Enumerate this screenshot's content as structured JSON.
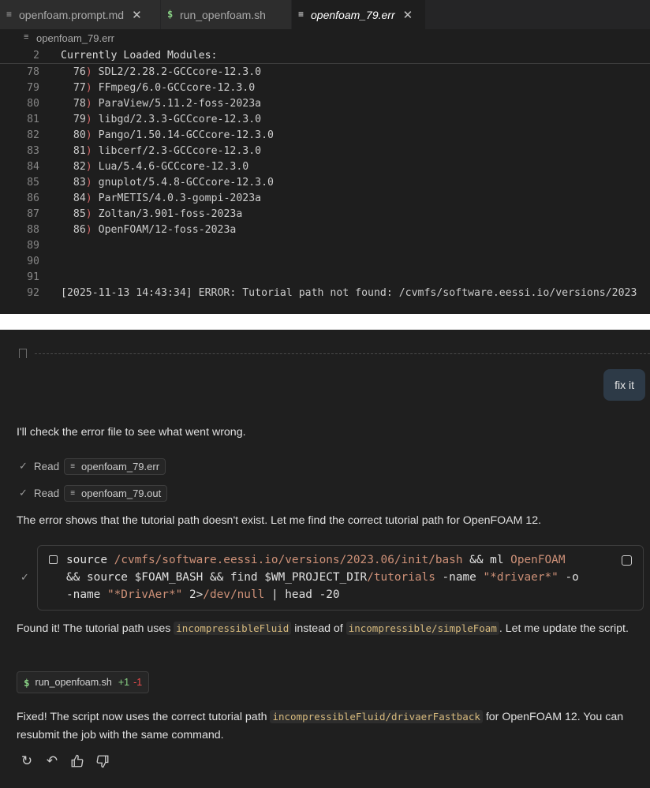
{
  "tabs": [
    {
      "icon": "lines-file-icon",
      "label": "openfoam.prompt.md",
      "close": "✕"
    },
    {
      "icon": "dollar-file-icon",
      "label": "run_openfoam.sh"
    },
    {
      "icon": "lines-file-icon",
      "label": "openfoam_79.err",
      "close": "✕",
      "active": true
    }
  ],
  "breadcrumb": {
    "file": "openfoam_79.err"
  },
  "editor": {
    "sticky": {
      "num": "2",
      "text": "Currently Loaded Modules:"
    },
    "lines": [
      {
        "num": "78",
        "idx": "76",
        "mod": "SDL2/2.28.2-GCCcore-12.3.0"
      },
      {
        "num": "79",
        "idx": "77",
        "mod": "FFmpeg/6.0-GCCcore-12.3.0"
      },
      {
        "num": "80",
        "idx": "78",
        "mod": "ParaView/5.11.2-foss-2023a"
      },
      {
        "num": "81",
        "idx": "79",
        "mod": "libgd/2.3.3-GCCcore-12.3.0"
      },
      {
        "num": "82",
        "idx": "80",
        "mod": "Pango/1.50.14-GCCcore-12.3.0"
      },
      {
        "num": "83",
        "idx": "81",
        "mod": "libcerf/2.3-GCCcore-12.3.0"
      },
      {
        "num": "84",
        "idx": "82",
        "mod": "Lua/5.4.6-GCCcore-12.3.0"
      },
      {
        "num": "85",
        "idx": "83",
        "mod": "gnuplot/5.4.8-GCCcore-12.3.0"
      },
      {
        "num": "86",
        "idx": "84",
        "mod": "ParMETIS/4.0.3-gompi-2023a"
      },
      {
        "num": "87",
        "idx": "85",
        "mod": "Zoltan/3.901-foss-2023a"
      },
      {
        "num": "88",
        "idx": "86",
        "mod": "OpenFOAM/12-foss-2023a"
      }
    ],
    "empty_lines": [
      "89",
      "90",
      "91"
    ],
    "error_line": {
      "num": "92",
      "text": "[2025-11-13 14:43:34] ERROR: Tutorial path not found: /cvmfs/software.eessi.io/versions/2023"
    }
  },
  "chat": {
    "user_message": "fix it",
    "p1": "I'll check the error file to see what went wrong.",
    "read1": {
      "verb": "Read",
      "file": "openfoam_79.err"
    },
    "read2": {
      "verb": "Read",
      "file": "openfoam_79.out"
    },
    "p2": "The error shows that the tutorial path doesn't exist. Let me find the correct tutorial path for OpenFOAM 12.",
    "command": {
      "t1": "source ",
      "t2": "/cvmfs/software.eessi.io/versions/2023.06/init/bash",
      "t3": " && ml ",
      "t4": "OpenFOAM",
      "t5": "&& source $FOAM_BASH && find $WM_PROJECT_DIR",
      "t6": "/tutorials",
      "t7": " -name ",
      "t8": "\"*drivaer*\"",
      "t9": " -o",
      "t10": "-name ",
      "t11": "\"*DrivAer*\"",
      "t12": " 2>",
      "t13": "/dev/null",
      "t14": " | head -20"
    },
    "p3": {
      "a": "Found it! The tutorial path uses ",
      "code1": "incompressibleFluid",
      "b": " instead of ",
      "code2": "incompressible/simpleFoam",
      "c": ". Let me update the script."
    },
    "edit_chip": {
      "file": "run_openfoam.sh",
      "plus": "+1",
      "minus": "-1"
    },
    "p4": {
      "a": "Fixed! The script now uses the correct tutorial path ",
      "code": "incompressibleFluid/drivaerFastback",
      "b": " for OpenFOAM 12. You can resubmit the job with the same command."
    },
    "actions": [
      "retry-icon",
      "undo-icon",
      "thumbs-up-icon",
      "thumbs-down-icon"
    ]
  }
}
